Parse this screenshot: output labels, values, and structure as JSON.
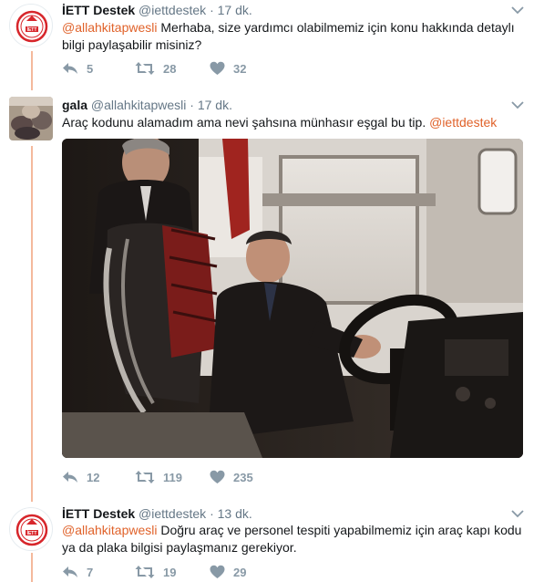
{
  "tweets": [
    {
      "name": "İETT Destek",
      "handle": "@iettdestek",
      "time": "17 dk.",
      "mention": "@allahkitapwesli",
      "text": " Merhaba, size yardımcı olabilmemiz için konu hakkında detaylı bilgi paylaşabilir misiniz?",
      "replies": "5",
      "retweets": "28",
      "likes": "32"
    },
    {
      "name": "gala",
      "handle": "@allahkitapwesli",
      "time": "17 dk.",
      "text": "Araç kodunu alamadım ama nevi şahsına münhasır eşgal bu tip. ",
      "mention": "@iettdestek",
      "replies": "12",
      "retweets": "119",
      "likes": "235"
    },
    {
      "name": "İETT Destek",
      "handle": "@iettdestek",
      "time": "13 dk.",
      "mention": "@allahkitapwesli",
      "text": " Doğru araç ve personel tespiti yapabilmemiz için araç kapı kodu ya da plaka bilgisi paylaşmanız gerekiyor.",
      "replies": "7",
      "retweets": "19",
      "likes": "29"
    }
  ],
  "logo_text": "İETT",
  "colors": {
    "accent": "#e0622a",
    "thread_line": "#f4b99c",
    "logo_red": "#d7262b",
    "muted": "#8899a6"
  },
  "icons": [
    "reply-icon",
    "retweet-icon",
    "like-icon",
    "chevron-down-icon"
  ]
}
